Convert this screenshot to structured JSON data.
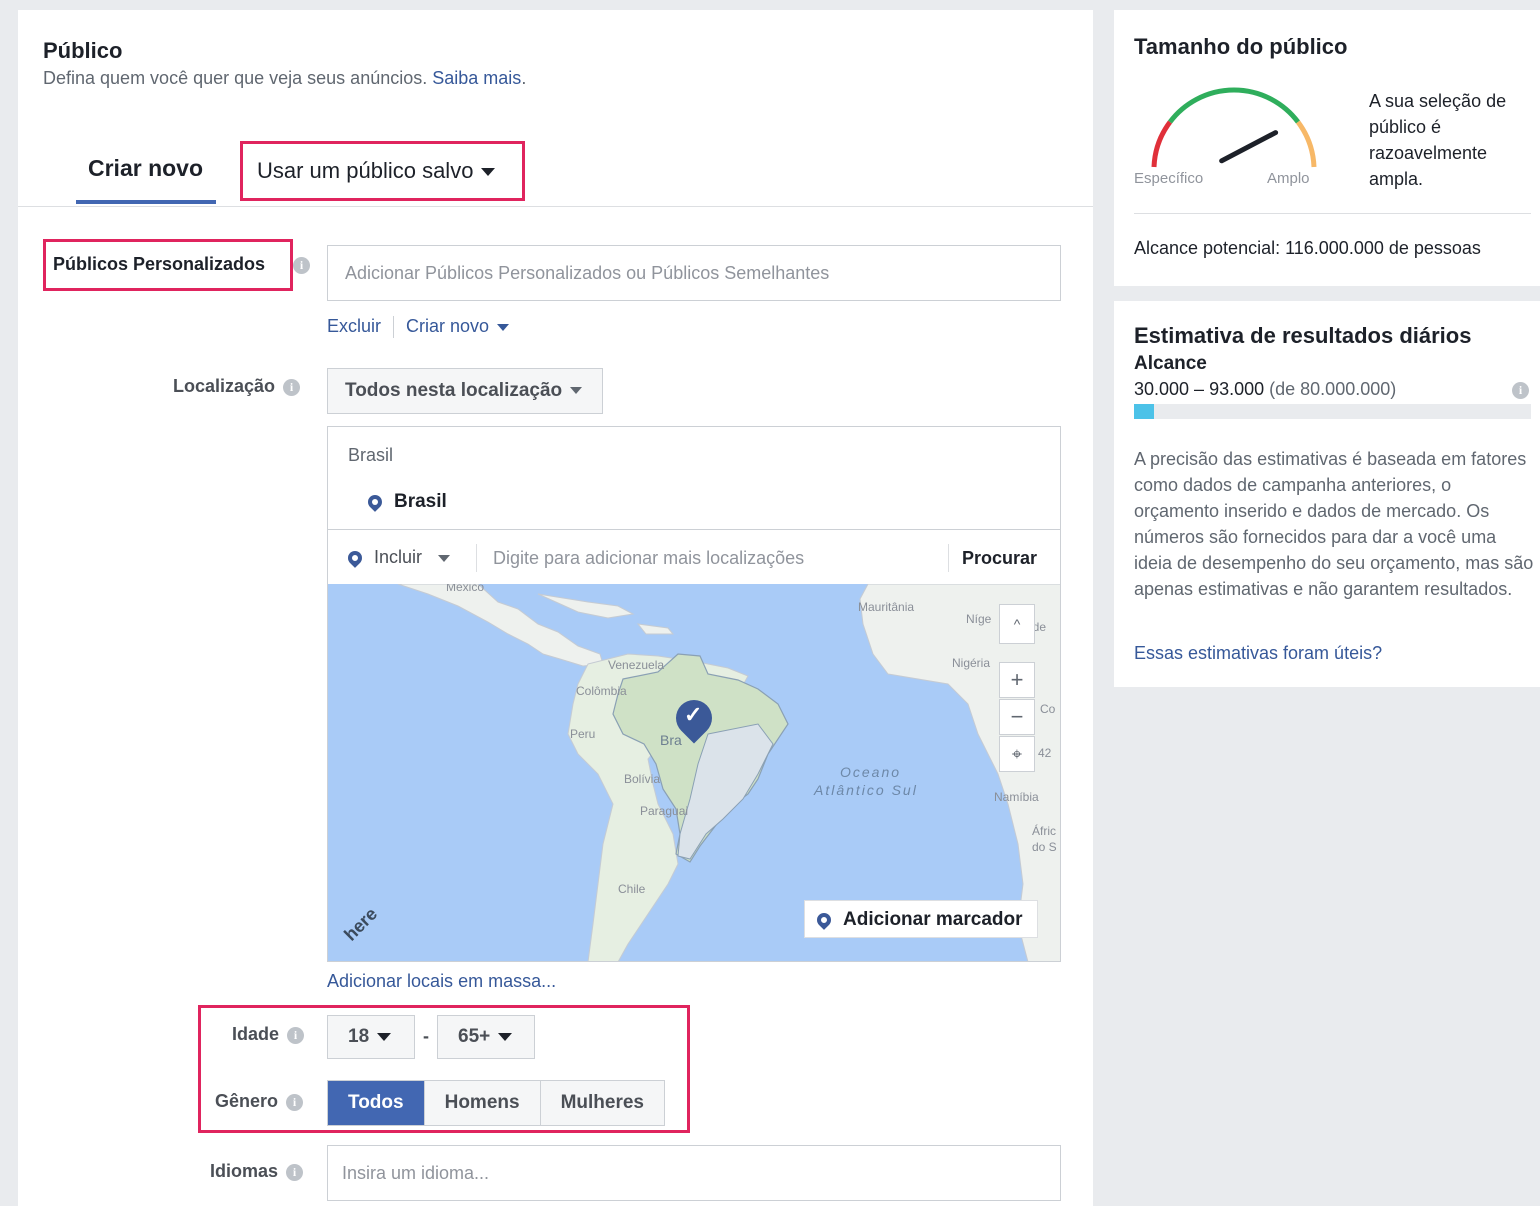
{
  "audience": {
    "title": "Público",
    "subtitle": "Defina quem você quer que veja seus anúncios.",
    "learn_more": "Saiba mais",
    "tabs": {
      "create_new": "Criar novo",
      "use_saved": "Usar um público salvo"
    }
  },
  "custom_audiences": {
    "label": "Públicos Personalizados",
    "placeholder": "Adicionar Públicos Personalizados ou Públicos Semelhantes",
    "exclude_link": "Excluir",
    "create_new_link": "Criar novo"
  },
  "location": {
    "label": "Localização",
    "dropdown": "Todos nesta localização",
    "country_heading": "Brasil",
    "selected": "Brasil",
    "include": "Incluir",
    "search_placeholder": "Digite para adicionar mais localizações",
    "search_button": "Procurar",
    "add_marker": "Adicionar marcador",
    "bulk_link": "Adicionar locais em massa...",
    "map_logo": "here",
    "map_labels": {
      "mexico": "México",
      "mauritania": "Mauritânia",
      "niger": "Níge",
      "niger_suffix": "ade",
      "nigeria": "Nigéria",
      "venezuela": "Venezuela",
      "colombia": "Colômbia",
      "peru": "Peru",
      "brazil": "Bra",
      "bolivia": "Bolívia",
      "paraguay": "Paraguai",
      "chile": "Chile",
      "ocean_line1": "Oceano",
      "ocean_line2": "Atlântico Sul",
      "namibia": "Namíbia",
      "africa_line1": "Áfric",
      "africa_line2": "do S",
      "congo": "Co",
      "digits": "42",
      "zoom_in": "+",
      "zoom_out": "−",
      "scroll_up": "^"
    }
  },
  "age": {
    "label": "Idade",
    "min": "18",
    "max": "65+",
    "dash": "-"
  },
  "gender": {
    "label": "Gênero",
    "options": [
      "Todos",
      "Homens",
      "Mulheres"
    ]
  },
  "languages": {
    "label": "Idiomas",
    "placeholder": "Insira um idioma..."
  },
  "audience_size": {
    "title": "Tamanho do público",
    "specific": "Específico",
    "broad": "Amplo",
    "description": "A sua seleção de público é razoavelmente ampla.",
    "potential_reach": "Alcance potencial: 116.000.000 de pessoas",
    "gauge_level": 0.78
  },
  "daily_estimate": {
    "title": "Estimativa de resultados diários",
    "reach_label": "Alcance",
    "range": "30.000 – 93.000",
    "range_total": "(de 80.000.000)",
    "bar_fill_fraction": 0.05,
    "description": "A precisão das estimativas é baseada em fatores como dados de campanha anteriores, o orçamento inserido e dados de mercado. Os números são fornecidos para dar a você uma ideia de desempenho do seu orçamento, mas são apenas estimativas e não garantem resultados.",
    "feedback_link": "Essas estimativas foram úteis?"
  },
  "colors": {
    "accent": "#4267b2",
    "highlight": "#e0245e",
    "link": "#365899",
    "reach_bar": "#4cc2e8"
  }
}
